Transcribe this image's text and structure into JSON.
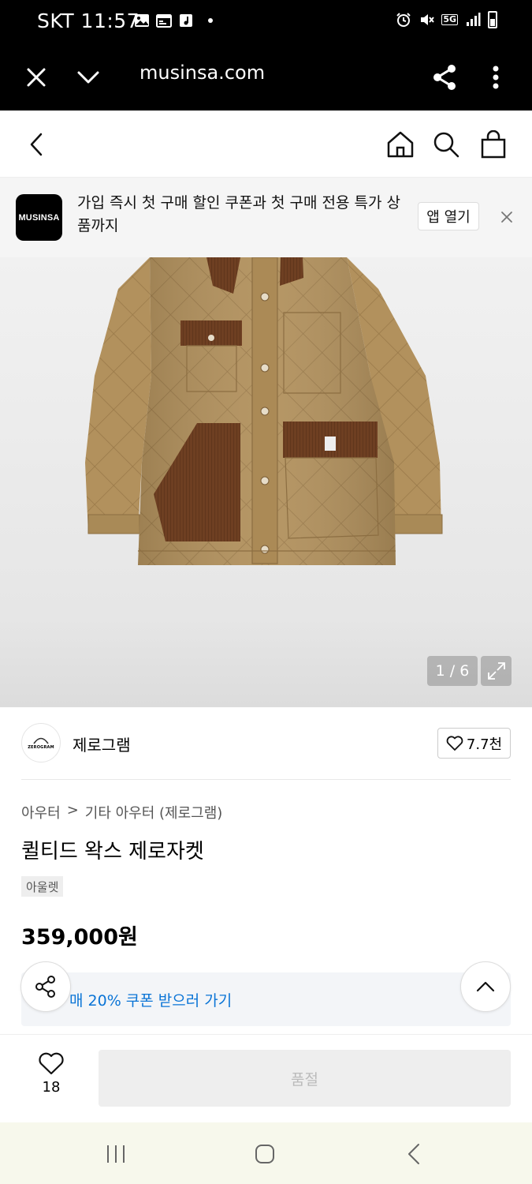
{
  "status_bar": {
    "carrier_time": "SKT 11:57",
    "network": "5G",
    "left_icons": [
      "gallery-icon",
      "calendar-icon",
      "music-icon",
      "dot"
    ],
    "right_icons": [
      "alarm-icon",
      "mute-icon",
      "5g-icon",
      "signal-icon",
      "battery-icon"
    ]
  },
  "browser": {
    "url": "musinsa.com"
  },
  "app_banner": {
    "logo_text": "MUSINSA",
    "message": "가입 즉시 첫 구매 할인 쿠폰과 첫 구매 전용 특가 상품까지",
    "open_app_label": "앱 열기"
  },
  "gallery": {
    "counter": "1 / 6"
  },
  "brand": {
    "logo_text": "ZEROGRAM",
    "name": "제로그램",
    "likes": "7.7천"
  },
  "product": {
    "breadcrumb": [
      "아우터",
      ">",
      "기타 아우터 (제로그램)"
    ],
    "title": "퀼티드 왁스 제로자켓",
    "badge": "아울렛",
    "price": "359,000원",
    "coupon_text": "매 20% 쿠폰 받으러 가기"
  },
  "purchase_bar": {
    "like_count": "18",
    "buy_label": "품절"
  },
  "colors": {
    "accent_blue": "#0a74d6",
    "jacket_tan": "#b08f5c",
    "corduroy_brown": "#6e3f22",
    "nav_bg": "#f7f8ec"
  }
}
